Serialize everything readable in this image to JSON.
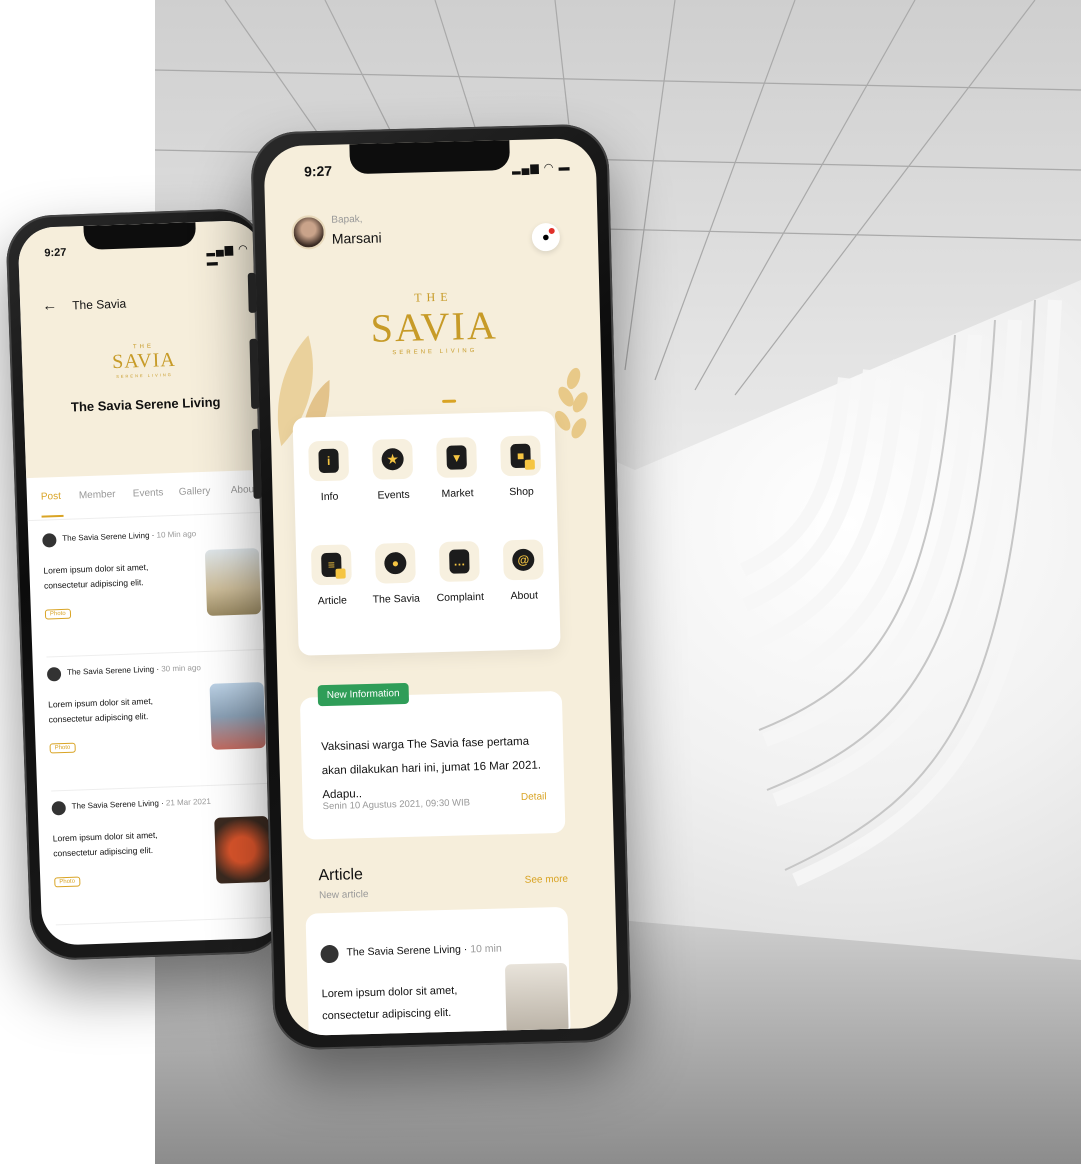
{
  "back_phone": {
    "status_time": "9:27",
    "status_icons": "▂▄▆ ◠ ▬",
    "header_title": "The Savia",
    "brand": {
      "the": "THE",
      "name": "SAVIA",
      "sub": "SERENE LIVING"
    },
    "community_name": "The Savia Serene Living",
    "tabs": [
      "Post",
      "Member",
      "Events",
      "Gallery",
      "About"
    ],
    "posts": [
      {
        "author": "The Savia Serene Living",
        "time": "10 Min ago",
        "body": "Lorem ipsum dolor sit amet, consectetur adipiscing elit.",
        "tag": "Photo"
      },
      {
        "author": "The Savia Serene Living",
        "time": "30 min ago",
        "body": "Lorem ipsum dolor sit amet, consectetur adipiscing elit.",
        "tag": "Photo"
      },
      {
        "author": "The Savia Serene Living",
        "time": "21 Mar 2021",
        "body": "Lorem ipsum dolor sit amet, consectetur adipiscing elit.",
        "tag": "Photo"
      }
    ]
  },
  "front_phone": {
    "status_time": "9:27",
    "status_icons": "▂▄▆ ◠ ▬",
    "greeting": {
      "salutation": "Bapak,",
      "name": "Marsani"
    },
    "brand": {
      "the": "THE",
      "name": "SAVIA",
      "sub": "SERENE LIVING"
    },
    "menu": [
      {
        "label": "Info",
        "glyph": "i",
        "icon": "info-icon"
      },
      {
        "label": "Events",
        "glyph": "★",
        "icon": "events-icon"
      },
      {
        "label": "Market",
        "glyph": "▾",
        "icon": "market-icon"
      },
      {
        "label": "Shop",
        "glyph": "■",
        "icon": "shop-icon"
      },
      {
        "label": "Article",
        "glyph": "≡",
        "icon": "article-icon"
      },
      {
        "label": "The Savia",
        "glyph": "●",
        "icon": "the-savia-icon"
      },
      {
        "label": "Complaint",
        "glyph": "…",
        "icon": "complaint-icon"
      },
      {
        "label": "About",
        "glyph": "@",
        "icon": "about-icon"
      }
    ],
    "info": {
      "badge": "New Information",
      "text": "Vaksinasi warga The Savia fase pertama akan dilakukan hari ini, jumat 16 Mar 2021. Adapu..",
      "date": "Senin 10 Agustus 2021, 09:30 WIB",
      "detail": "Detail"
    },
    "article": {
      "title": "Article",
      "subtitle": "New article",
      "see_more": "See more",
      "author": "The Savia Serene Living",
      "time": "10 min",
      "body": "Lorem ipsum dolor sit amet, consectetur adipiscing elit."
    }
  },
  "colors": {
    "accent": "#d9a425",
    "cream": "#f6eedb",
    "green_badge": "#2f9d58",
    "notification": "#e0302a"
  }
}
